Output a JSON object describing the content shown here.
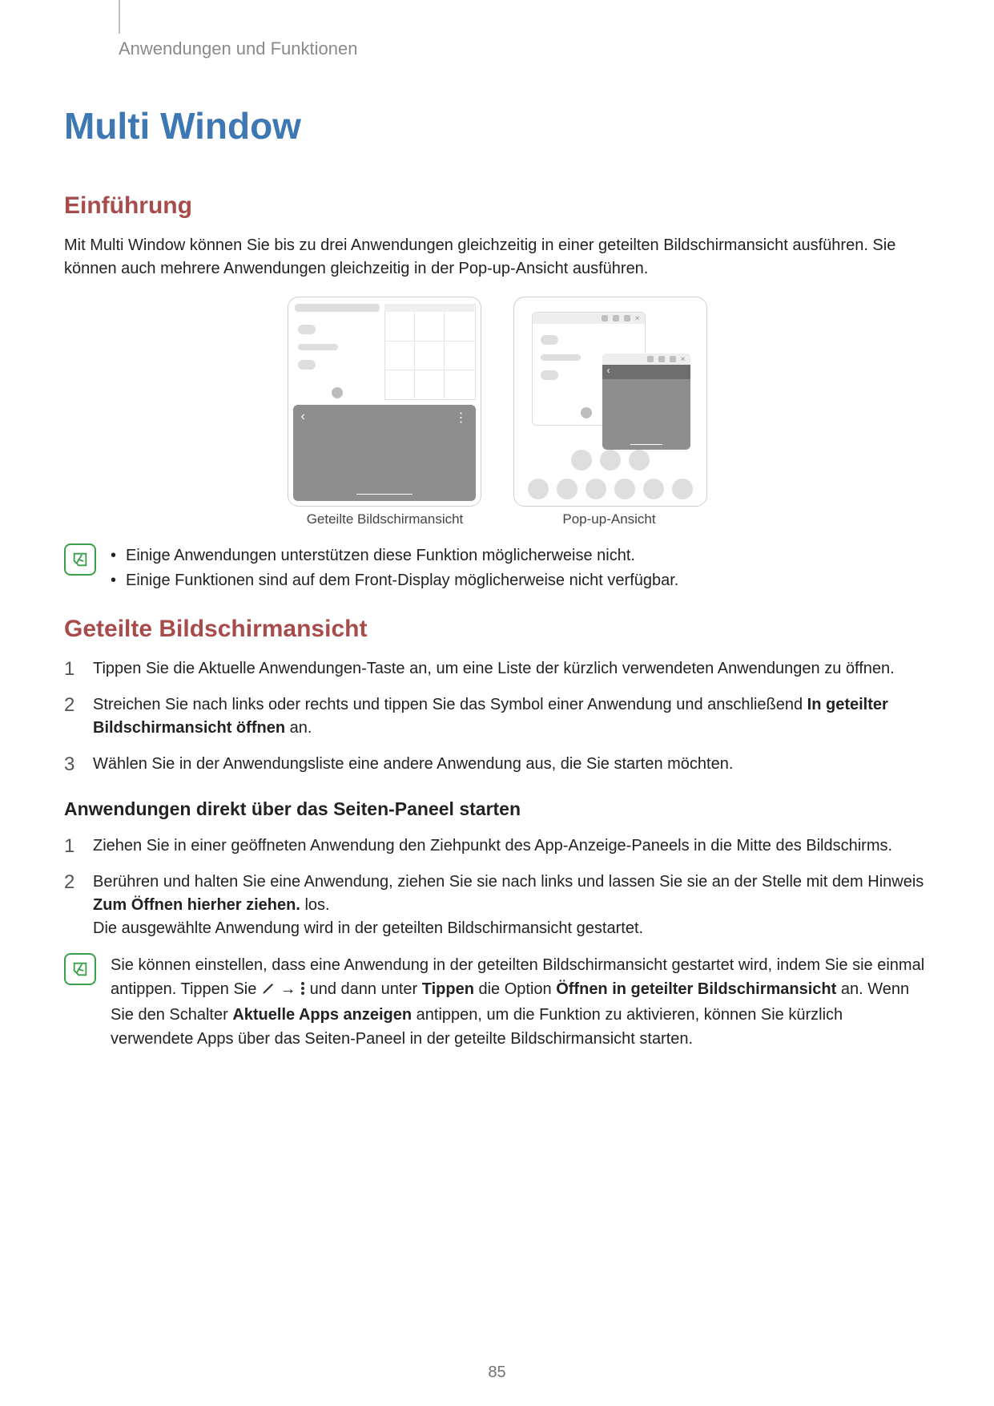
{
  "breadcrumb": "Anwendungen und Funktionen",
  "h1": "Multi Window",
  "intro": {
    "heading": "Einführung",
    "paragraph": "Mit Multi Window können Sie bis zu drei Anwendungen gleichzeitig in einer geteilten Bildschirmansicht ausführen. Sie können auch mehrere Anwendungen gleichzeitig in der Pop-up-Ansicht ausführen."
  },
  "captions": {
    "split": "Geteilte Bildschirmansicht",
    "popup": "Pop-up-Ansicht"
  },
  "note1": {
    "items": [
      "Einige Anwendungen unterstützen diese Funktion möglicherweise nicht.",
      "Einige Funktionen sind auf dem Front-Display möglicherweise nicht verfügbar."
    ]
  },
  "split": {
    "heading": "Geteilte Bildschirmansicht",
    "steps": {
      "s1": "Tippen Sie die Aktuelle Anwendungen-Taste an, um eine Liste der kürzlich verwendeten Anwendungen zu öffnen.",
      "s2_pre": "Streichen Sie nach links oder rechts und tippen Sie das Symbol einer Anwendung und anschließend ",
      "s2_bold": "In geteilter Bildschirmansicht öffnen",
      "s2_post": " an.",
      "s3": "Wählen Sie in der Anwendungsliste eine andere Anwendung aus, die Sie starten möchten."
    }
  },
  "edge": {
    "heading": "Anwendungen direkt über das Seiten-Paneel starten",
    "steps": {
      "s1": "Ziehen Sie in einer geöffneten Anwendung den Ziehpunkt des App-Anzeige-Paneels in die Mitte des Bildschirms.",
      "s2_pre": "Berühren und halten Sie eine Anwendung, ziehen Sie sie nach links und lassen Sie sie an der Stelle mit dem Hinweis ",
      "s2_bold": "Zum Öffnen hierher ziehen.",
      "s2_post": " los.",
      "s2_line2": "Die ausgewählte Anwendung wird in der geteilten Bildschirmansicht gestartet."
    }
  },
  "note2": {
    "t1": "Sie können einstellen, dass eine Anwendung in der geteilten Bildschirmansicht gestartet wird, indem Sie sie einmal antippen. Tippen Sie ",
    "arrow": "→",
    "t2": " und dann unter ",
    "b_tippen": "Tippen",
    "t3": " die Option ",
    "b_open_split": "Öffnen in geteilter Bildschirmansicht",
    "t4": " an. Wenn Sie den Schalter ",
    "b_recent": "Aktuelle Apps anzeigen",
    "t5": " antippen, um die Funktion zu aktivieren, können Sie kürzlich verwendete Apps über das Seiten-Paneel in der geteilte Bildschirmansicht starten."
  },
  "page_number": "85"
}
